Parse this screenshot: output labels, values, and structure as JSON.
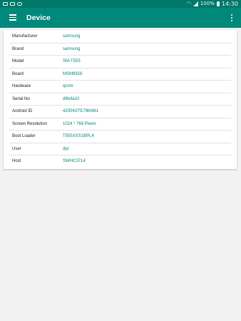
{
  "status_bar": {
    "battery_text": "100%",
    "time": "14:30",
    "icons": [
      "notification-icon",
      "image-icon",
      "cloud-icon",
      "wifi-icon",
      "signal-icon",
      "battery-icon"
    ]
  },
  "app_bar": {
    "title": "Device",
    "menu_icon": "hamburger-menu-icon",
    "overflow_icon": "more-vert-icon"
  },
  "colors": {
    "primary": "#00897b",
    "primary_dark": "#00796b",
    "value_text": "#00897b"
  },
  "device_info": [
    {
      "label": "Manufacturer",
      "value": "samsung"
    },
    {
      "label": "Brand",
      "value": "samsung"
    },
    {
      "label": "Model",
      "value": "SM-T555"
    },
    {
      "label": "Board",
      "value": "MSM8916"
    },
    {
      "label": "Hardware",
      "value": "qcom"
    },
    {
      "label": "Serial No",
      "value": "df6efa10"
    },
    {
      "label": "Android ID",
      "value": "4200437f179bf461"
    },
    {
      "label": "Screen Resolution",
      "value": "1024 * 768 Pixels"
    },
    {
      "label": "Boot Loader",
      "value": "T555XXS1BPL4"
    },
    {
      "label": "User",
      "value": "dpi"
    },
    {
      "label": "Host",
      "value": "SWHC3714"
    }
  ]
}
